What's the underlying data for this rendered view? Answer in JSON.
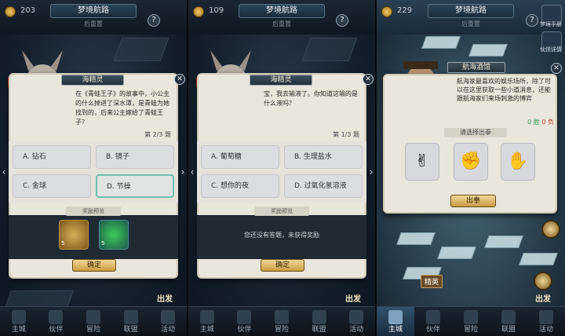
{
  "screens": [
    {
      "coins": "203",
      "title": "梦境航路",
      "status_left": "",
      "status_right": "后重置",
      "dialog_title": "海精灵",
      "hp": "8",
      "hp_label": "",
      "question": "在《青蛙王子》的故事中，小公主的什么掉进了深水潭，是青蛙为她找到的，后来公主嫁给了青蛙王子？",
      "progress": "第 2/3 题",
      "options": [
        "A. 钻石",
        "B. 镜子",
        "C. 金球",
        "D. 节操"
      ],
      "selected_option": 3,
      "reward_title": "奖励预览",
      "rewards": [
        {
          "icon": "gold-coin-icon",
          "count": "5"
        },
        {
          "icon": "energy-icon",
          "count": "5"
        }
      ],
      "no_reward_text": "",
      "confirm": "确定",
      "depart": "出发"
    },
    {
      "coins": "109",
      "title": "梦境航路",
      "status_left": "",
      "status_right": "后重置",
      "dialog_title": "海精灵",
      "hp": "8",
      "hp_label": "",
      "question": "宝，我去输液了。你知道这输的是什么液吗？",
      "progress": "第 1/3 题",
      "options": [
        "A. 葡萄糖",
        "B. 生理盐水",
        "C. 想你的夜",
        "D. 过氧化氢溶液"
      ],
      "selected_option": -1,
      "reward_title": "奖励预览",
      "rewards": [],
      "no_reward_text": "您还没有答题，未获得奖励",
      "confirm": "确定",
      "depart": "出发"
    },
    {
      "coins": "229",
      "title": "梦境航路",
      "status_left": "",
      "status_right": "后重置",
      "side_buttons": [
        "梦境手册",
        "伙伴详情"
      ],
      "dialog_title": "航海酒馆",
      "hp": "8",
      "hp_label": "",
      "desc": "航海家最喜欢的娱乐场所，除了可以在这里获取一些小道消息，还能跟航海家们来场刺激的博弈",
      "score_win": "0 胜",
      "score_lose": "0 负",
      "rps_title": "请选择出拳",
      "rps": [
        "✌",
        "✊",
        "✋"
      ],
      "shoot": "出拳",
      "elite": "精英",
      "depart": "出发"
    }
  ],
  "bottom_nav": [
    "主城",
    "伙伴",
    "冒险",
    "联盟",
    "活动"
  ],
  "active_nav_index": 0,
  "colors": {
    "accent_gold": "#c99d45",
    "selected_border": "#6fc1b0",
    "win": "#2a9a4a",
    "lose": "#c0392b"
  }
}
